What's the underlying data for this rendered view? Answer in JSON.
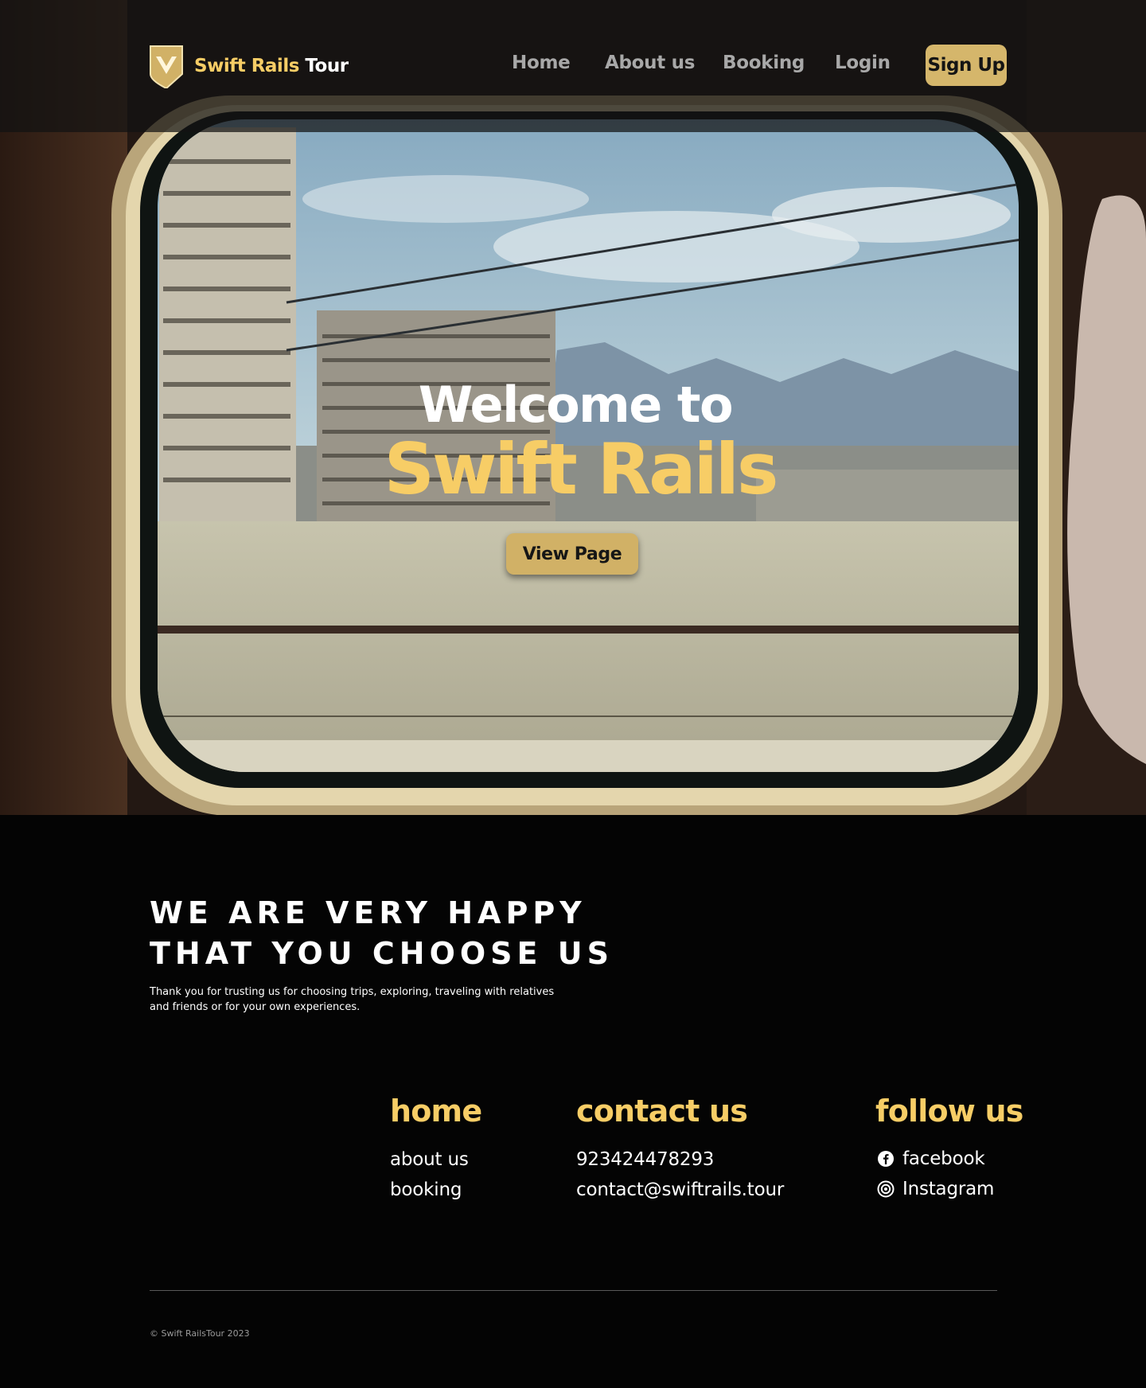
{
  "header": {
    "logo": {
      "brand_gold": "Swift Rails",
      "brand_white": "Tour",
      "icon": "shield-logo-icon"
    },
    "nav": [
      {
        "label": "Home"
      },
      {
        "label": "About us"
      },
      {
        "label": "Booking"
      },
      {
        "label": "Login"
      }
    ],
    "signup_label": "Sign Up"
  },
  "hero": {
    "welcome": "Welcome to",
    "brand": "Swift Rails",
    "button_label": "View Page"
  },
  "about": {
    "heading_line1": "WE ARE VERY HAPPY",
    "heading_line2": "THAT YOU CHOOSE US",
    "text_line1": "Thank you for trusting us for choosing trips, exploring, traveling with relatives",
    "text_line2": "and friends or for your own experiences."
  },
  "footer": {
    "home": {
      "title": "home",
      "links": [
        "about us",
        "booking"
      ]
    },
    "contact": {
      "title": "contact us",
      "phone": "923424478293",
      "email": "contact@swiftrails.tour"
    },
    "follow": {
      "title": "follow us",
      "facebook": "facebook",
      "instagram": "Instagram"
    },
    "copyright": "© Swift RailsTour 2023"
  },
  "colors": {
    "accent": "#f7cd66",
    "button": "#d5b66b",
    "background": "#040404"
  }
}
